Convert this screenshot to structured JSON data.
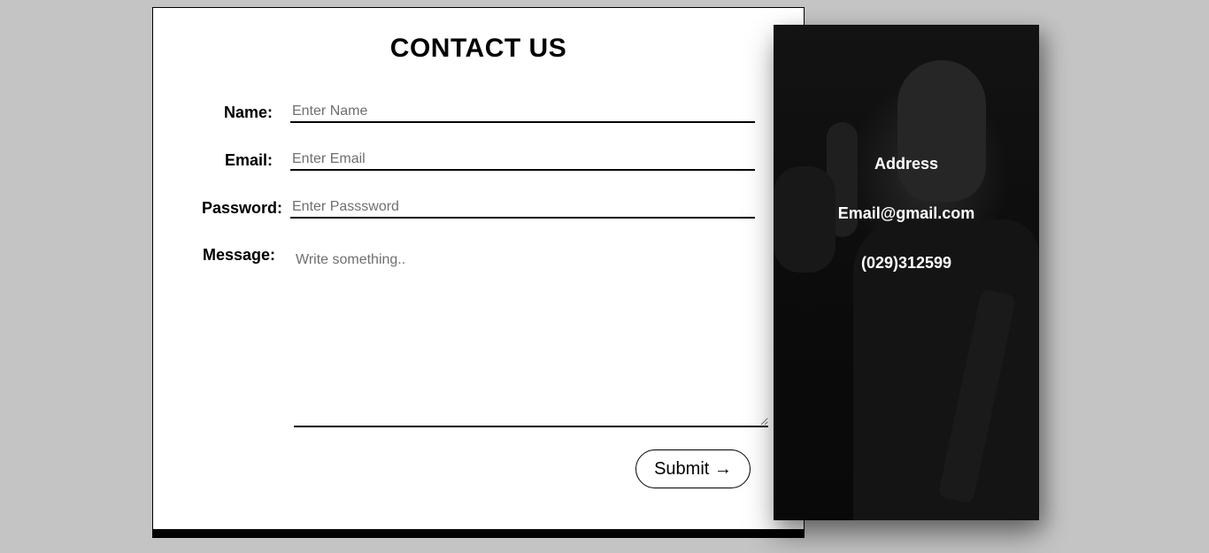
{
  "form": {
    "title": "CONTACT US",
    "name_label": "Name:",
    "name_placeholder": "Enter Name",
    "email_label": "Email:",
    "email_placeholder": "Enter Email",
    "password_label": "Password:",
    "password_placeholder": "Enter Passsword",
    "message_label": "Message:",
    "message_placeholder": "Write something..",
    "submit_label": "Submit →"
  },
  "info": {
    "address": "Address",
    "email": "Email@gmail.com",
    "phone": "(029)312599"
  }
}
